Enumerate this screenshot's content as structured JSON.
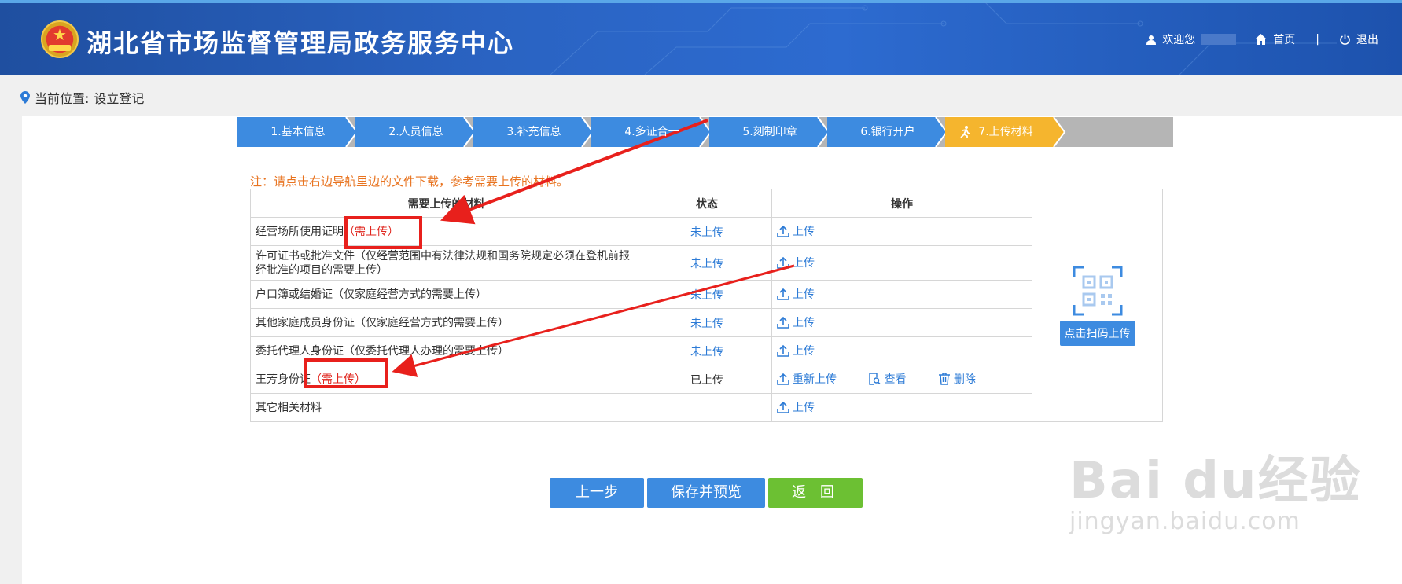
{
  "header": {
    "site_title": "湖北省市场监督管理局政务服务中心",
    "welcome": "欢迎您",
    "home": "首页",
    "separator": "|",
    "logout": "退出"
  },
  "breadcrumb": {
    "label": "当前位置:",
    "current": "设立登记"
  },
  "steps": [
    {
      "label": "1.基本信息",
      "state": "done"
    },
    {
      "label": "2.人员信息",
      "state": "done"
    },
    {
      "label": "3.补充信息",
      "state": "done"
    },
    {
      "label": "4.多证合一",
      "state": "done"
    },
    {
      "label": "5.刻制印章",
      "state": "done"
    },
    {
      "label": "6.银行开户",
      "state": "done"
    },
    {
      "label": "7.上传材料",
      "state": "current"
    }
  ],
  "note": "注：请点击右边导航里边的文件下载，参考需要上传的材料。",
  "table": {
    "headers": {
      "material": "需要上传的材料",
      "status": "状态",
      "ops": "操作"
    },
    "rows": [
      {
        "name": "经营场所使用证明",
        "required": "（需上传）",
        "status": "未上传",
        "ops": [
          "上传"
        ]
      },
      {
        "name": "许可证书或批准文件（仅经营范围中有法律法规和国务院规定必须在登机前报经批准的项目的需要上传）",
        "required": "",
        "status": "未上传",
        "ops": [
          "上传"
        ]
      },
      {
        "name": "户口簿或结婚证（仅家庭经营方式的需要上传）",
        "required": "",
        "status": "未上传",
        "ops": [
          "上传"
        ]
      },
      {
        "name": "其他家庭成员身份证（仅家庭经营方式的需要上传）",
        "required": "",
        "status": "未上传",
        "ops": [
          "上传"
        ]
      },
      {
        "name": "委托代理人身份证（仅委托代理人办理的需要上传）",
        "required": "",
        "status": "未上传",
        "ops": [
          "上传"
        ]
      },
      {
        "name": "王芳身份证",
        "required": "（需上传）",
        "status": "已上传",
        "ops": [
          "重新上传",
          "查看",
          "删除"
        ]
      },
      {
        "name": "其它相关材料",
        "required": "",
        "status": "",
        "ops": [
          "上传"
        ]
      }
    ],
    "qr_button": "点击扫码上传"
  },
  "buttons": {
    "prev": "上一步",
    "save": "保存并预览",
    "back": "返 回"
  },
  "watermark": {
    "logo": "Bai du经验",
    "url": "jingyan.baidu.com"
  },
  "colors": {
    "header_blue": "#2a63c2",
    "step_blue": "#3d8be0",
    "step_current": "#f5b52e",
    "step_pending": "#b5b5b5",
    "link_blue": "#2d7bd6",
    "required_red": "#e0261e",
    "note_orange": "#e8731f",
    "back_green": "#6cc033"
  }
}
